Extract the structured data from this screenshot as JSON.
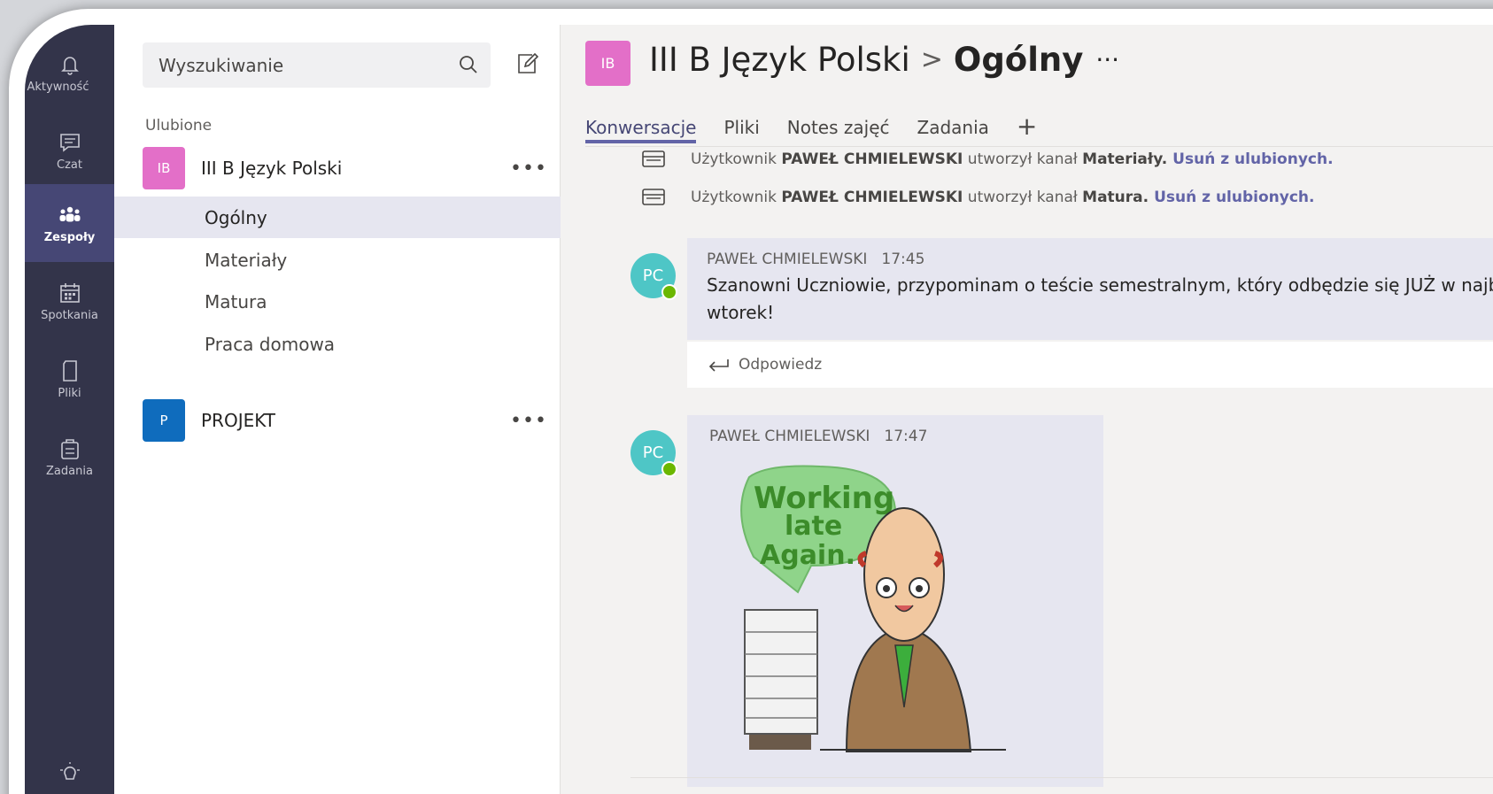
{
  "rail": {
    "items": [
      {
        "label": "Aktywność",
        "icon": "bell-icon"
      },
      {
        "label": "Czat",
        "icon": "chat-icon"
      },
      {
        "label": "Zespoły",
        "icon": "teams-icon"
      },
      {
        "label": "Spotkania",
        "icon": "calendar-icon"
      },
      {
        "label": "Pliki",
        "icon": "file-icon"
      },
      {
        "label": "Zadania",
        "icon": "assignments-icon"
      }
    ],
    "active": "Zespoły",
    "help_icon": "lightbulb-icon"
  },
  "list": {
    "search_placeholder": "Wyszukiwanie",
    "section_label": "Ulubione",
    "teams": [
      {
        "initials": "IB",
        "name": "III B Język Polski",
        "color": "#e36fc8",
        "more": "•••"
      },
      {
        "initials": "P",
        "name": "PROJEKT",
        "color": "#0f6cbd",
        "more": "•••"
      }
    ],
    "channels": [
      "Ogólny",
      "Materiały",
      "Matura",
      "Praca domowa"
    ],
    "active_channel": "Ogólny"
  },
  "header": {
    "avatar_initials": "IB",
    "team": "III B Język Polski",
    "separator": ">",
    "channel": "Ogólny",
    "more": "···"
  },
  "tabs": {
    "items": [
      "Konwersacje",
      "Pliki",
      "Notes zajęć",
      "Zadania"
    ],
    "active": "Konwersacje",
    "add_label": "+"
  },
  "system_messages": [
    {
      "prefix": "Użytkownik",
      "user": "PAWEŁ CHMIELEWSKI",
      "action": "utworzył kanał",
      "channel": "Materiały.",
      "link": "Usuń z ulubionych."
    },
    {
      "prefix": "Użytkownik",
      "user": "PAWEŁ CHMIELEWSKI",
      "action": "utworzył kanał",
      "channel": "Matura.",
      "link": "Usuń z ulubionych."
    }
  ],
  "messages": [
    {
      "author_initials": "PC",
      "author": "PAWEŁ CHMIELEWSKI",
      "time": "17:45",
      "text": "Szanowni Uczniowie,  przypominam o teście semestralnym, który odbędzie się JUŻ w najbliższy wtorek!",
      "reply_label": "Odpowiedz"
    },
    {
      "author_initials": "PC",
      "author": "PAWEŁ CHMIELEWSKI",
      "time": "17:47",
      "sticker_lines": [
        "Working",
        "late",
        "Again..."
      ]
    }
  ],
  "colors": {
    "rail_bg": "#33344a",
    "rail_active": "#464775",
    "accent": "#6264a7",
    "avatar_teal": "#4ec6c6",
    "presence": "#6bb700",
    "card_bg": "#e6e6f0"
  }
}
